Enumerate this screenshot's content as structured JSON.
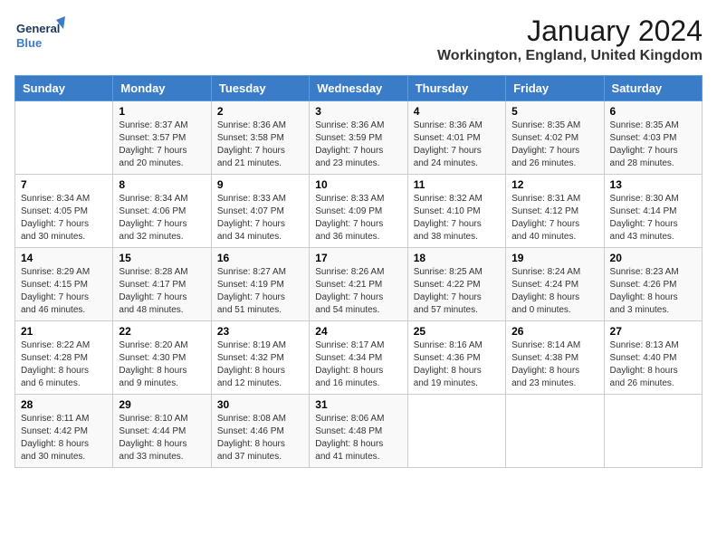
{
  "logo": {
    "text_general": "General",
    "text_blue": "Blue"
  },
  "title": "January 2024",
  "subtitle": "Workington, England, United Kingdom",
  "days_header": [
    "Sunday",
    "Monday",
    "Tuesday",
    "Wednesday",
    "Thursday",
    "Friday",
    "Saturday"
  ],
  "weeks": [
    [
      {
        "day": "",
        "info": ""
      },
      {
        "day": "1",
        "info": "Sunrise: 8:37 AM\nSunset: 3:57 PM\nDaylight: 7 hours\nand 20 minutes."
      },
      {
        "day": "2",
        "info": "Sunrise: 8:36 AM\nSunset: 3:58 PM\nDaylight: 7 hours\nand 21 minutes."
      },
      {
        "day": "3",
        "info": "Sunrise: 8:36 AM\nSunset: 3:59 PM\nDaylight: 7 hours\nand 23 minutes."
      },
      {
        "day": "4",
        "info": "Sunrise: 8:36 AM\nSunset: 4:01 PM\nDaylight: 7 hours\nand 24 minutes."
      },
      {
        "day": "5",
        "info": "Sunrise: 8:35 AM\nSunset: 4:02 PM\nDaylight: 7 hours\nand 26 minutes."
      },
      {
        "day": "6",
        "info": "Sunrise: 8:35 AM\nSunset: 4:03 PM\nDaylight: 7 hours\nand 28 minutes."
      }
    ],
    [
      {
        "day": "7",
        "info": "Sunrise: 8:34 AM\nSunset: 4:05 PM\nDaylight: 7 hours\nand 30 minutes."
      },
      {
        "day": "8",
        "info": "Sunrise: 8:34 AM\nSunset: 4:06 PM\nDaylight: 7 hours\nand 32 minutes."
      },
      {
        "day": "9",
        "info": "Sunrise: 8:33 AM\nSunset: 4:07 PM\nDaylight: 7 hours\nand 34 minutes."
      },
      {
        "day": "10",
        "info": "Sunrise: 8:33 AM\nSunset: 4:09 PM\nDaylight: 7 hours\nand 36 minutes."
      },
      {
        "day": "11",
        "info": "Sunrise: 8:32 AM\nSunset: 4:10 PM\nDaylight: 7 hours\nand 38 minutes."
      },
      {
        "day": "12",
        "info": "Sunrise: 8:31 AM\nSunset: 4:12 PM\nDaylight: 7 hours\nand 40 minutes."
      },
      {
        "day": "13",
        "info": "Sunrise: 8:30 AM\nSunset: 4:14 PM\nDaylight: 7 hours\nand 43 minutes."
      }
    ],
    [
      {
        "day": "14",
        "info": "Sunrise: 8:29 AM\nSunset: 4:15 PM\nDaylight: 7 hours\nand 46 minutes."
      },
      {
        "day": "15",
        "info": "Sunrise: 8:28 AM\nSunset: 4:17 PM\nDaylight: 7 hours\nand 48 minutes."
      },
      {
        "day": "16",
        "info": "Sunrise: 8:27 AM\nSunset: 4:19 PM\nDaylight: 7 hours\nand 51 minutes."
      },
      {
        "day": "17",
        "info": "Sunrise: 8:26 AM\nSunset: 4:21 PM\nDaylight: 7 hours\nand 54 minutes."
      },
      {
        "day": "18",
        "info": "Sunrise: 8:25 AM\nSunset: 4:22 PM\nDaylight: 7 hours\nand 57 minutes."
      },
      {
        "day": "19",
        "info": "Sunrise: 8:24 AM\nSunset: 4:24 PM\nDaylight: 8 hours\nand 0 minutes."
      },
      {
        "day": "20",
        "info": "Sunrise: 8:23 AM\nSunset: 4:26 PM\nDaylight: 8 hours\nand 3 minutes."
      }
    ],
    [
      {
        "day": "21",
        "info": "Sunrise: 8:22 AM\nSunset: 4:28 PM\nDaylight: 8 hours\nand 6 minutes."
      },
      {
        "day": "22",
        "info": "Sunrise: 8:20 AM\nSunset: 4:30 PM\nDaylight: 8 hours\nand 9 minutes."
      },
      {
        "day": "23",
        "info": "Sunrise: 8:19 AM\nSunset: 4:32 PM\nDaylight: 8 hours\nand 12 minutes."
      },
      {
        "day": "24",
        "info": "Sunrise: 8:17 AM\nSunset: 4:34 PM\nDaylight: 8 hours\nand 16 minutes."
      },
      {
        "day": "25",
        "info": "Sunrise: 8:16 AM\nSunset: 4:36 PM\nDaylight: 8 hours\nand 19 minutes."
      },
      {
        "day": "26",
        "info": "Sunrise: 8:14 AM\nSunset: 4:38 PM\nDaylight: 8 hours\nand 23 minutes."
      },
      {
        "day": "27",
        "info": "Sunrise: 8:13 AM\nSunset: 4:40 PM\nDaylight: 8 hours\nand 26 minutes."
      }
    ],
    [
      {
        "day": "28",
        "info": "Sunrise: 8:11 AM\nSunset: 4:42 PM\nDaylight: 8 hours\nand 30 minutes."
      },
      {
        "day": "29",
        "info": "Sunrise: 8:10 AM\nSunset: 4:44 PM\nDaylight: 8 hours\nand 33 minutes."
      },
      {
        "day": "30",
        "info": "Sunrise: 8:08 AM\nSunset: 4:46 PM\nDaylight: 8 hours\nand 37 minutes."
      },
      {
        "day": "31",
        "info": "Sunrise: 8:06 AM\nSunset: 4:48 PM\nDaylight: 8 hours\nand 41 minutes."
      },
      {
        "day": "",
        "info": ""
      },
      {
        "day": "",
        "info": ""
      },
      {
        "day": "",
        "info": ""
      }
    ]
  ]
}
